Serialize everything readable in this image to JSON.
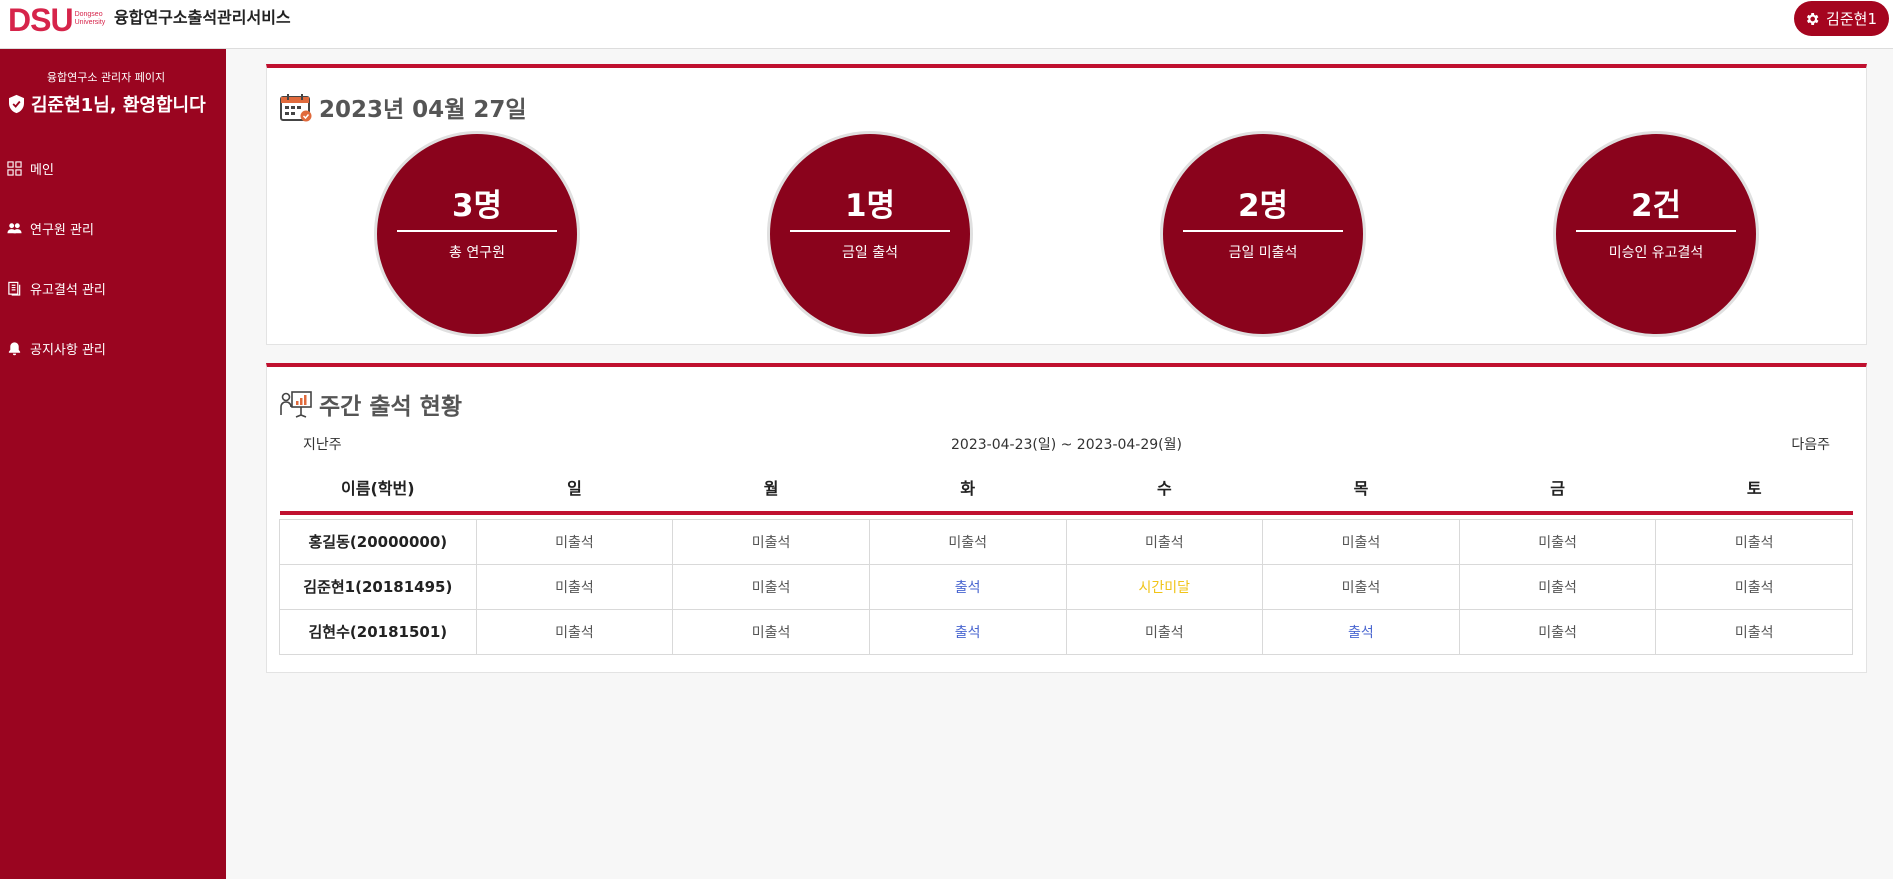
{
  "header": {
    "logo_text": "DSU",
    "logo_sub_1": "Dongseo",
    "logo_sub_2": "University",
    "app_title": "융합연구소출석관리서비스",
    "user_label": "김준현1",
    "brand_color": "#9a0520",
    "accent_color": "#c0102f"
  },
  "sidebar": {
    "caption": "융합연구소 관리자 페이지",
    "welcome": "김준현1님, 환영합니다",
    "welcome_icon": "shield-icon",
    "items": [
      {
        "label": "메인",
        "icon": "grid-icon"
      },
      {
        "label": "연구원 관리",
        "icon": "people-icon"
      },
      {
        "label": "유고결석 관리",
        "icon": "document-icon"
      },
      {
        "label": "공지사항 관리",
        "icon": "bell-icon"
      }
    ]
  },
  "summary": {
    "date": "2023년 04월 27일",
    "date_icon": "calendar-icon",
    "stats": [
      {
        "value": "3명",
        "label": "총 연구원"
      },
      {
        "value": "1명",
        "label": "금일 출석"
      },
      {
        "value": "2명",
        "label": "금일 미출석"
      },
      {
        "value": "2건",
        "label": "미승인 유고결석"
      }
    ]
  },
  "weekly": {
    "title": "주간 출석 현황",
    "title_icon": "presentation-chart-icon",
    "prev_label": "지난주",
    "next_label": "다음주",
    "range": "2023-04-23(일) ~ 2023-04-29(월)",
    "columns": [
      "이름(학번)",
      "일",
      "월",
      "화",
      "수",
      "목",
      "금",
      "토"
    ],
    "rows": [
      {
        "name": "홍길동(20000000)",
        "days": [
          "미출석",
          "미출석",
          "미출석",
          "미출석",
          "미출석",
          "미출석",
          "미출석"
        ]
      },
      {
        "name": "김준현1(20181495)",
        "days": [
          "미출석",
          "미출석",
          "출석",
          "시간미달",
          "미출석",
          "미출석",
          "미출석"
        ]
      },
      {
        "name": "김현수(20181501)",
        "days": [
          "미출석",
          "미출석",
          "출석",
          "미출석",
          "출석",
          "미출석",
          "미출석"
        ]
      }
    ],
    "status_colors": {
      "출석": "#4a66d0",
      "시간미달": "#f0c419",
      "미출석": "#555555"
    }
  }
}
